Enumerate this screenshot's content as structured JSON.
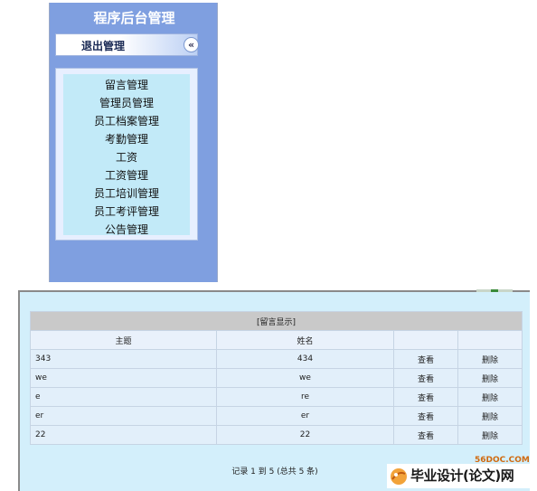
{
  "sidebar": {
    "title": "程序后台管理",
    "logout_label": "退出管理",
    "collapse_glyph": "«",
    "collapse_icon": "double-chevron-left-icon",
    "items": [
      {
        "label": "留言管理"
      },
      {
        "label": "管理员管理"
      },
      {
        "label": "员工档案管理"
      },
      {
        "label": "考勤管理"
      },
      {
        "label": "工资"
      },
      {
        "label": "工资管理"
      },
      {
        "label": "员工培训管理"
      },
      {
        "label": "员工考评管理"
      },
      {
        "label": "公告管理"
      }
    ]
  },
  "table": {
    "caption": "[留言显示]",
    "headers": {
      "subject": "主题",
      "name": "姓名"
    },
    "rows": [
      {
        "subject": "343",
        "name": "434",
        "view": "查看",
        "delete": "删除"
      },
      {
        "subject": "we",
        "name": "we",
        "view": "查看",
        "delete": "删除"
      },
      {
        "subject": "e",
        "name": "re",
        "view": "查看",
        "delete": "删除"
      },
      {
        "subject": "er",
        "name": "er",
        "view": "查看",
        "delete": "删除"
      },
      {
        "subject": "22",
        "name": "22",
        "view": "查看",
        "delete": "删除"
      }
    ]
  },
  "pager": {
    "text": "记录 1 到 5 (总共 5 条)"
  },
  "watermark": {
    "url": "56DOC.COM",
    "text": "毕业设计(论文)网"
  },
  "colors": {
    "sidebar_bg": "#7f9fe0",
    "menu_bg": "#c2eaf8",
    "panel_bg": "#d3effb",
    "watermark_accent": "#d06a10"
  }
}
